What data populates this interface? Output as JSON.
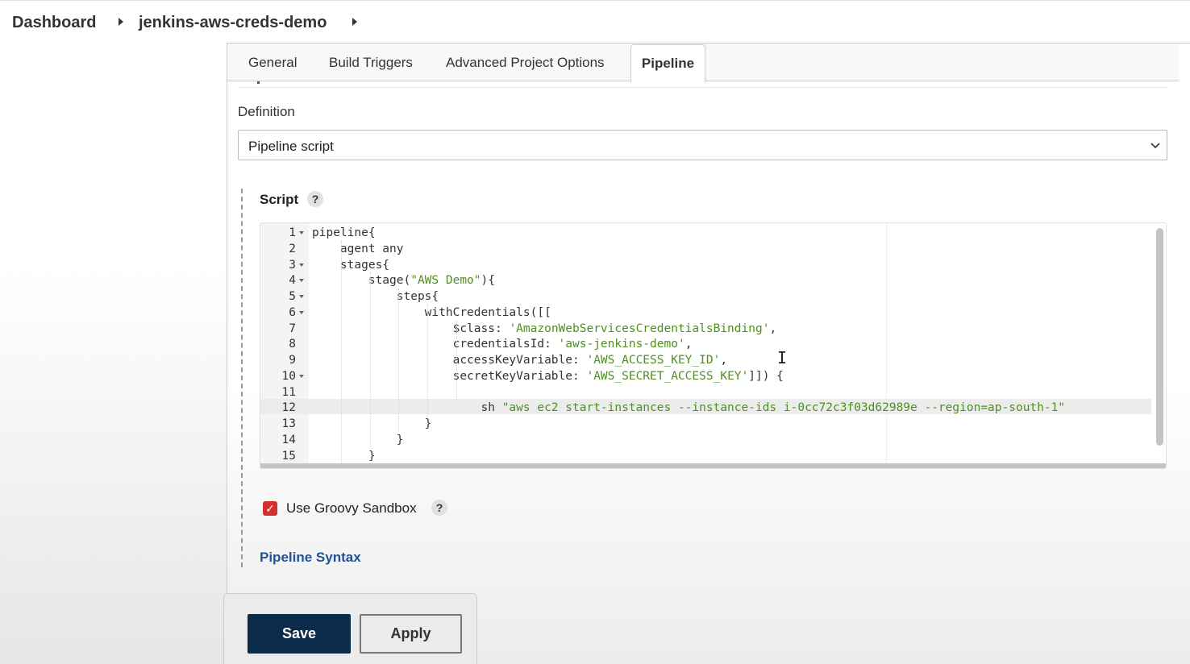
{
  "breadcrumb": {
    "dashboard": "Dashboard",
    "job": "jenkins-aws-creds-demo"
  },
  "tabs": [
    {
      "label": "General"
    },
    {
      "label": "Build Triggers"
    },
    {
      "label": "Advanced Project Options"
    },
    {
      "label": "Pipeline",
      "active": true
    }
  ],
  "definition": {
    "label": "Definition",
    "selected": "Pipeline script"
  },
  "script": {
    "label": "Script",
    "help": "?",
    "lines": [
      {
        "num": "1",
        "fold": true,
        "code": "pipeline{"
      },
      {
        "num": "2",
        "fold": false,
        "code": "    agent any"
      },
      {
        "num": "3",
        "fold": true,
        "code": "    stages{"
      },
      {
        "num": "4",
        "fold": true,
        "pre": "        stage(",
        "str": "\"AWS Demo\"",
        "post": "){"
      },
      {
        "num": "5",
        "fold": true,
        "code": "            steps{"
      },
      {
        "num": "6",
        "fold": true,
        "code": "                withCredentials([["
      },
      {
        "num": "7",
        "fold": false,
        "pre": "                    $class: ",
        "str": "'AmazonWebServicesCredentialsBinding'",
        "post": ","
      },
      {
        "num": "8",
        "fold": false,
        "pre": "                    credentialsId: ",
        "str": "'aws-jenkins-demo'",
        "post": ","
      },
      {
        "num": "9",
        "fold": false,
        "pre": "                    accessKeyVariable: ",
        "str": "'AWS_ACCESS_KEY_ID'",
        "post": ","
      },
      {
        "num": "10",
        "fold": true,
        "pre": "                    secretKeyVariable: ",
        "str": "'AWS_SECRET_ACCESS_KEY'",
        "post": "]]) {"
      },
      {
        "num": "11",
        "fold": false,
        "code": ""
      },
      {
        "num": "12",
        "fold": false,
        "pre": "                        sh ",
        "str": "\"aws ec2 start-instances --instance-ids i-0cc72c3f03d62989e --region=ap-south-1\"",
        "post": ""
      },
      {
        "num": "13",
        "fold": false,
        "code": "                }"
      },
      {
        "num": "14",
        "fold": false,
        "code": "            }"
      },
      {
        "num": "15",
        "fold": false,
        "code": "        }"
      }
    ]
  },
  "sandbox": {
    "label": "Use Groovy Sandbox",
    "checked": true,
    "help": "?"
  },
  "pipeline_syntax": "Pipeline Syntax",
  "buttons": {
    "save": "Save",
    "apply": "Apply"
  },
  "colors": {
    "save_bg": "#0b2b4a",
    "checkbox": "#d32f2f",
    "link": "#1f5394",
    "string": "#4e8f1f"
  }
}
